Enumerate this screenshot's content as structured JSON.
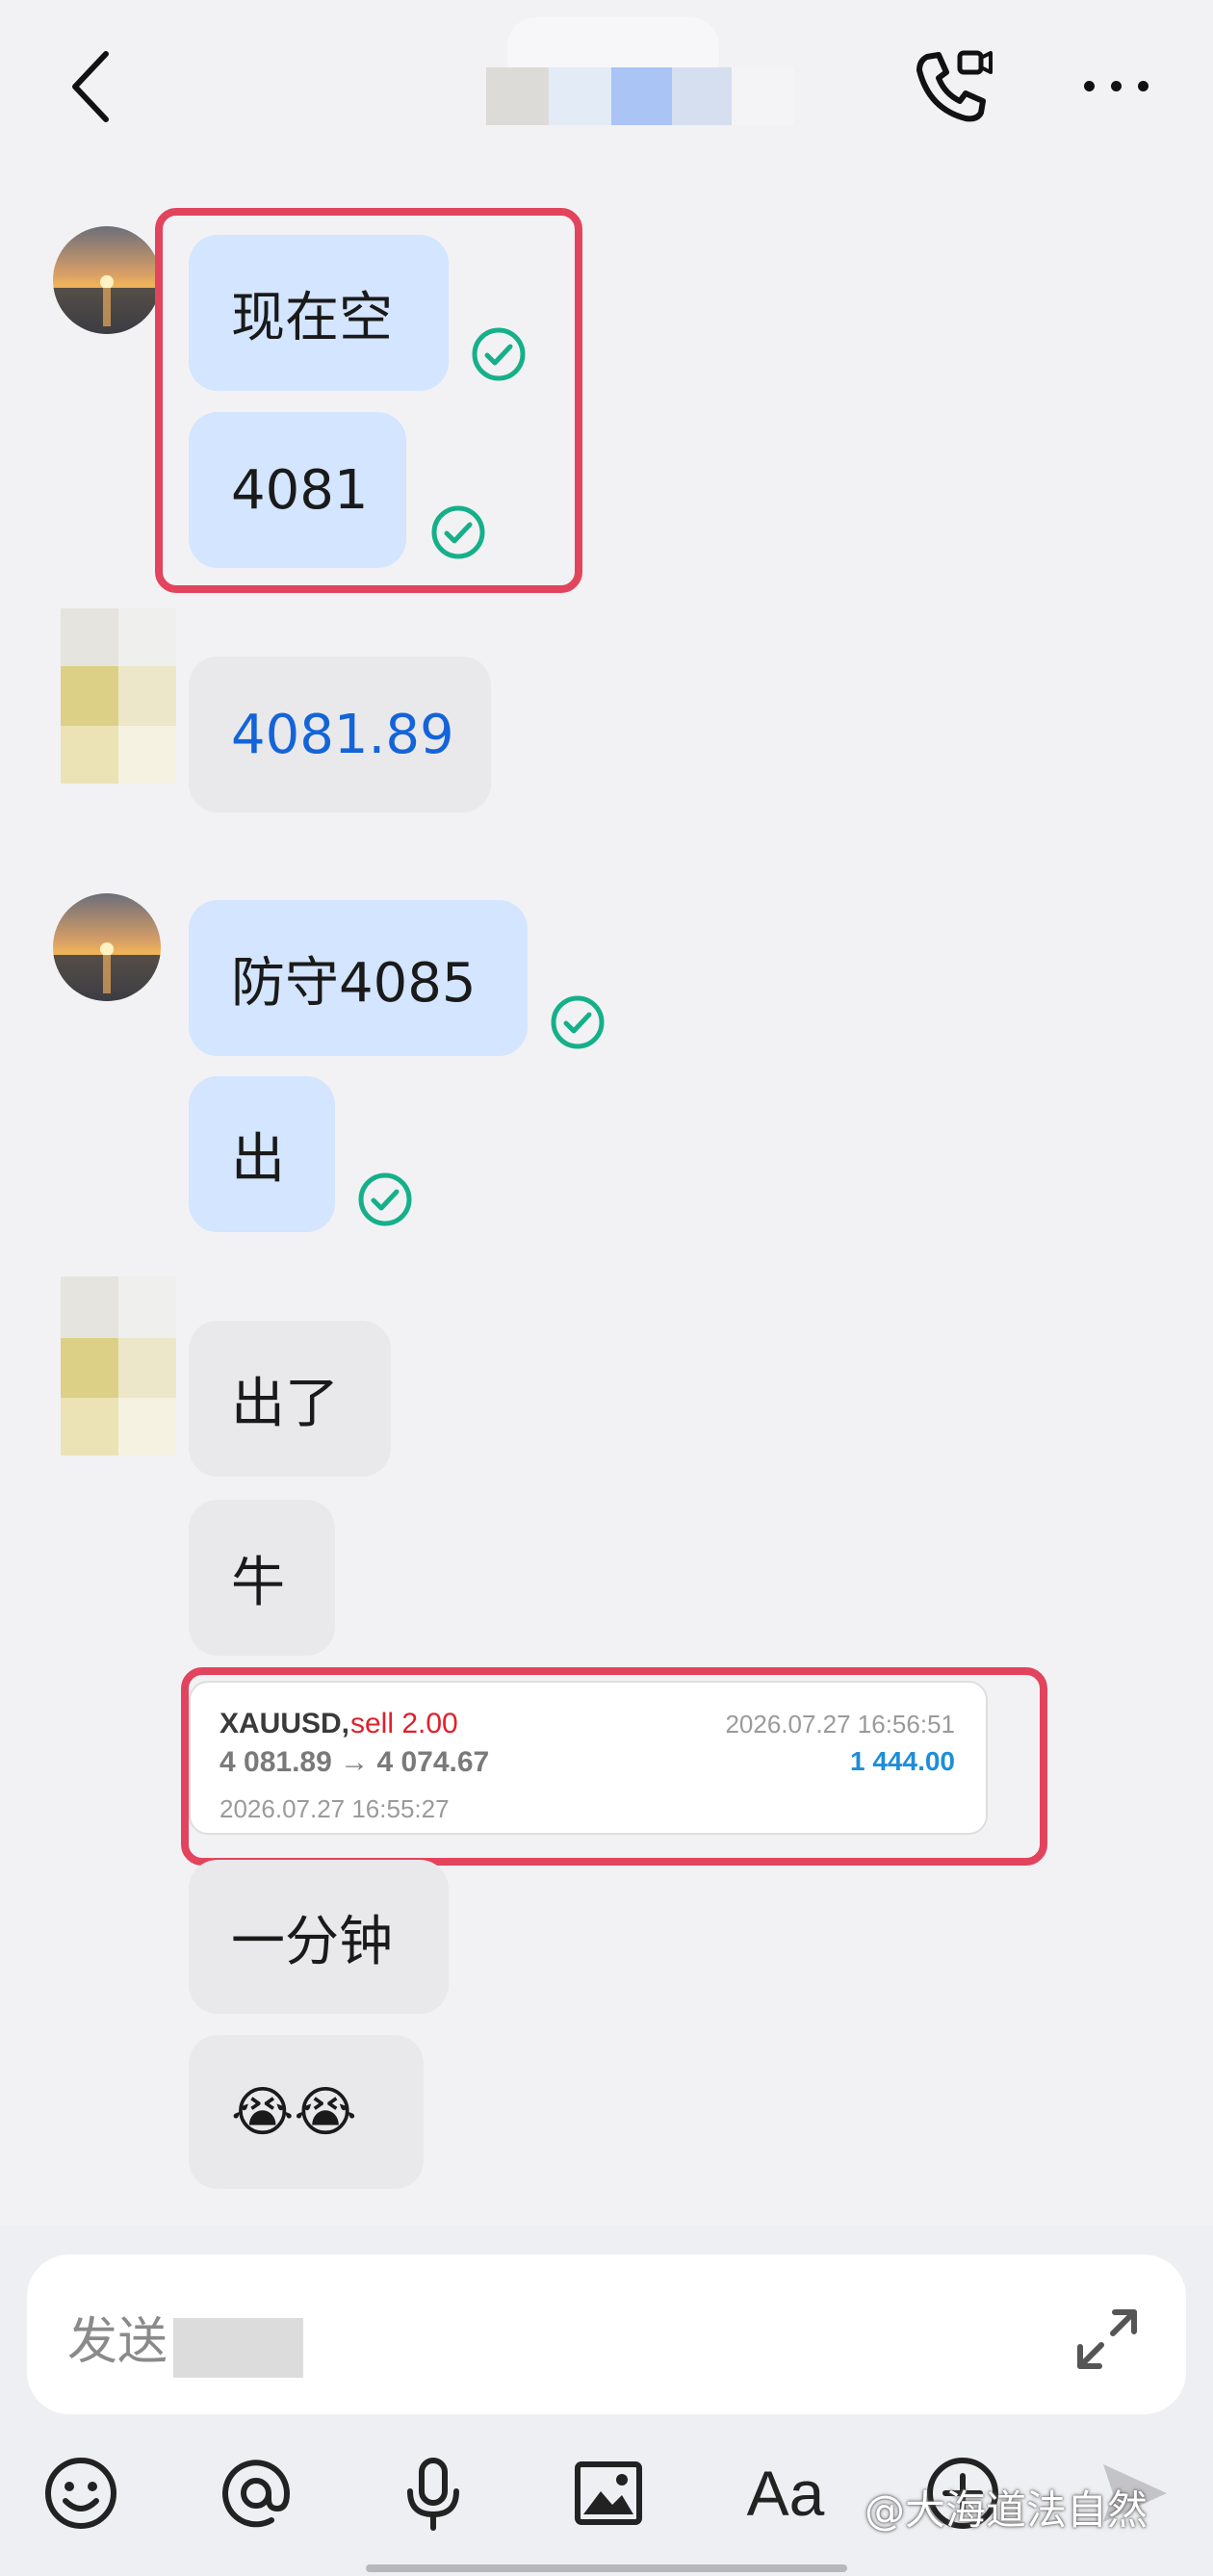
{
  "header": {
    "back_icon": "chevron-left-icon",
    "call_icon": "phone-video-icon",
    "more_icon": "more-horizontal-icon"
  },
  "messages": {
    "m1": "现在空",
    "m2": "4081",
    "m3": "4081.89",
    "m4": "防守4085",
    "m5": "出",
    "m6": "出了",
    "m7": "牛",
    "m8": "一分钟",
    "m9": "😭😭"
  },
  "trade_card": {
    "symbol": "XAUUSD,",
    "side": "sell 2.00",
    "prices": "4 081.89 → 4 074.67",
    "open_time": "2026.07.27 16:55:27",
    "close_time": "2026.07.27 16:56:51",
    "profit": "1 444.00"
  },
  "composer": {
    "placeholder": "发送",
    "tools": [
      "emoji-icon",
      "mention-icon",
      "microphone-icon",
      "image-icon",
      "font-icon",
      "add-icon",
      "send-icon"
    ],
    "font_label": "Aa"
  },
  "watermark": "@大海道法自然",
  "colors": {
    "outgoing_bubble": "#d3e5ff",
    "incoming_bubble": "#e9e9ec",
    "check": "#15b08a",
    "highlight": "#e2445d",
    "link_number": "#1464d9",
    "sell": "#e0202a",
    "profit": "#1e8ed8"
  }
}
